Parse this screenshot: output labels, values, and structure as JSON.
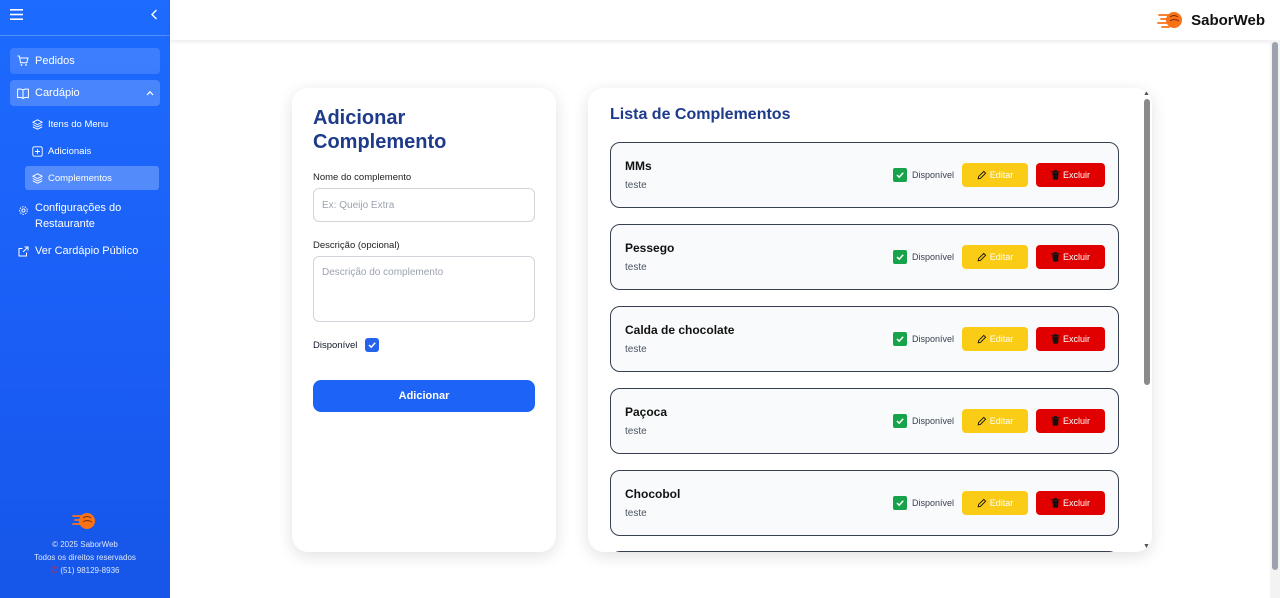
{
  "sidebar": {
    "nav": {
      "pedidos": "Pedidos",
      "cardapio": "Cardápio",
      "itens_menu": "Itens do Menu",
      "adicionais": "Adicionais",
      "complementos": "Complementos",
      "config_line1": "Configurações do",
      "config_line2": "Restaurante",
      "ver_cardapio": "Ver Cardápio Público"
    },
    "footer": {
      "copyright": "© 2025 SaborWeb",
      "rights": "Todos os direitos reservados",
      "phone": "(51) 98129-8936"
    }
  },
  "header": {
    "brand": "SaborWeb"
  },
  "form": {
    "title": "Adicionar Complemento",
    "name_label": "Nome do complemento",
    "name_placeholder": "Ex: Queijo Extra",
    "desc_label": "Descrição (opcional)",
    "desc_placeholder": "Descrição do complemento",
    "available_label": "Disponível",
    "available_checked": true,
    "submit_label": "Adicionar"
  },
  "list": {
    "title": "Lista de Complementos",
    "available_label": "Disponível",
    "edit_label": "Editar",
    "delete_label": "Excluir",
    "items": [
      {
        "name": "MMs",
        "description": "teste",
        "available": true
      },
      {
        "name": "Pessego",
        "description": "teste",
        "available": true
      },
      {
        "name": "Calda de chocolate",
        "description": "teste",
        "available": true
      },
      {
        "name": "Paçoca",
        "description": "teste",
        "available": true
      },
      {
        "name": "Chocobol",
        "description": "teste",
        "available": true
      }
    ]
  },
  "colors": {
    "sidebar_bg": "#1d6bff",
    "primary": "#1d63f5",
    "title": "#1e3a8a",
    "edit_button": "#facc15",
    "delete_button": "#e00000",
    "available_check": "#16a34a"
  },
  "icons": {
    "menu": "hamburger-icon",
    "collapse": "chevron-left-icon",
    "pedidos": "cart-icon",
    "cardapio": "book-icon",
    "itens": "layers-icon",
    "adicionais": "plus-square-icon",
    "complementos": "layers-icon",
    "config": "gear-icon",
    "ver_cardapio": "external-link-icon",
    "edit": "pencil-icon",
    "delete": "trash-icon"
  }
}
